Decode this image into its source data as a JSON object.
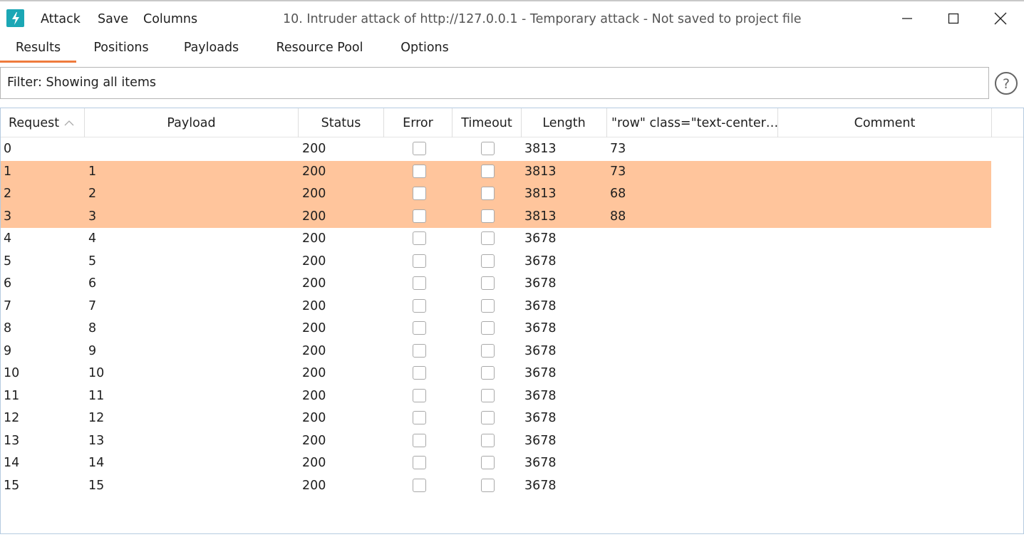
{
  "menu": {
    "attack": "Attack",
    "save": "Save",
    "columns": "Columns"
  },
  "window_title": "10. Intruder attack of http://127.0.0.1 - Temporary attack - Not saved to project file",
  "tabs": [
    "Results",
    "Positions",
    "Payloads",
    "Resource Pool",
    "Options"
  ],
  "active_tab": "Results",
  "filter": {
    "text": "Filter: Showing all items"
  },
  "columns": [
    "Request",
    "Payload",
    "Status",
    "Error",
    "Timeout",
    "Length",
    "\"row\" class=\"text-center…",
    "Comment"
  ],
  "sort_column": "Request",
  "highlight_color": "#ffc59c",
  "accent_color": "#ef7b3d",
  "rows": [
    {
      "request": "0",
      "payload": "",
      "status": "200",
      "error": false,
      "timeout": false,
      "length": "3813",
      "grep": "73",
      "comment": "",
      "highlight": false
    },
    {
      "request": "1",
      "payload": "1",
      "status": "200",
      "error": false,
      "timeout": false,
      "length": "3813",
      "grep": "73",
      "comment": "",
      "highlight": true
    },
    {
      "request": "2",
      "payload": "2",
      "status": "200",
      "error": false,
      "timeout": false,
      "length": "3813",
      "grep": "68",
      "comment": "",
      "highlight": true
    },
    {
      "request": "3",
      "payload": "3",
      "status": "200",
      "error": false,
      "timeout": false,
      "length": "3813",
      "grep": "88",
      "comment": "",
      "highlight": true
    },
    {
      "request": "4",
      "payload": "4",
      "status": "200",
      "error": false,
      "timeout": false,
      "length": "3678",
      "grep": "",
      "comment": "",
      "highlight": false
    },
    {
      "request": "5",
      "payload": "5",
      "status": "200",
      "error": false,
      "timeout": false,
      "length": "3678",
      "grep": "",
      "comment": "",
      "highlight": false
    },
    {
      "request": "6",
      "payload": "6",
      "status": "200",
      "error": false,
      "timeout": false,
      "length": "3678",
      "grep": "",
      "comment": "",
      "highlight": false
    },
    {
      "request": "7",
      "payload": "7",
      "status": "200",
      "error": false,
      "timeout": false,
      "length": "3678",
      "grep": "",
      "comment": "",
      "highlight": false
    },
    {
      "request": "8",
      "payload": "8",
      "status": "200",
      "error": false,
      "timeout": false,
      "length": "3678",
      "grep": "",
      "comment": "",
      "highlight": false
    },
    {
      "request": "9",
      "payload": "9",
      "status": "200",
      "error": false,
      "timeout": false,
      "length": "3678",
      "grep": "",
      "comment": "",
      "highlight": false
    },
    {
      "request": "10",
      "payload": "10",
      "status": "200",
      "error": false,
      "timeout": false,
      "length": "3678",
      "grep": "",
      "comment": "",
      "highlight": false
    },
    {
      "request": "11",
      "payload": "11",
      "status": "200",
      "error": false,
      "timeout": false,
      "length": "3678",
      "grep": "",
      "comment": "",
      "highlight": false
    },
    {
      "request": "12",
      "payload": "12",
      "status": "200",
      "error": false,
      "timeout": false,
      "length": "3678",
      "grep": "",
      "comment": "",
      "highlight": false
    },
    {
      "request": "13",
      "payload": "13",
      "status": "200",
      "error": false,
      "timeout": false,
      "length": "3678",
      "grep": "",
      "comment": "",
      "highlight": false
    },
    {
      "request": "14",
      "payload": "14",
      "status": "200",
      "error": false,
      "timeout": false,
      "length": "3678",
      "grep": "",
      "comment": "",
      "highlight": false
    },
    {
      "request": "15",
      "payload": "15",
      "status": "200",
      "error": false,
      "timeout": false,
      "length": "3678",
      "grep": "",
      "comment": "",
      "highlight": false
    }
  ]
}
